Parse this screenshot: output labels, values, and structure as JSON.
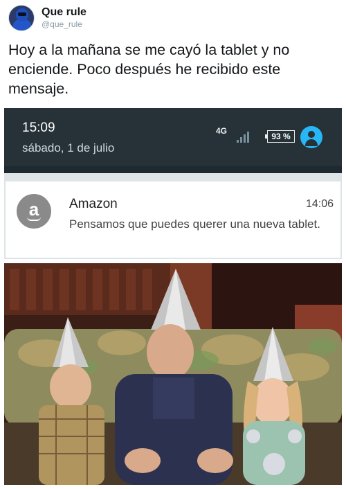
{
  "tweet": {
    "display_name": "Que rule",
    "handle": "@que_rule",
    "text": "Hoy a la mañana se me cayó la tablet y no enciende. Poco después he recibido este mensaje."
  },
  "status_bar": {
    "time": "15:09",
    "date": "sábado, 1 de julio",
    "network": "4G",
    "battery": "93 %"
  },
  "notification": {
    "logo_letter": "a",
    "app": "Amazon",
    "time": "14:06",
    "message": "Pensamos que puedes querer una nueva tablet."
  },
  "colors": {
    "status_bar_bg": "#263238",
    "user_icon": "#29b6f6",
    "amazon_logo_bg": "#8a8a8a"
  }
}
